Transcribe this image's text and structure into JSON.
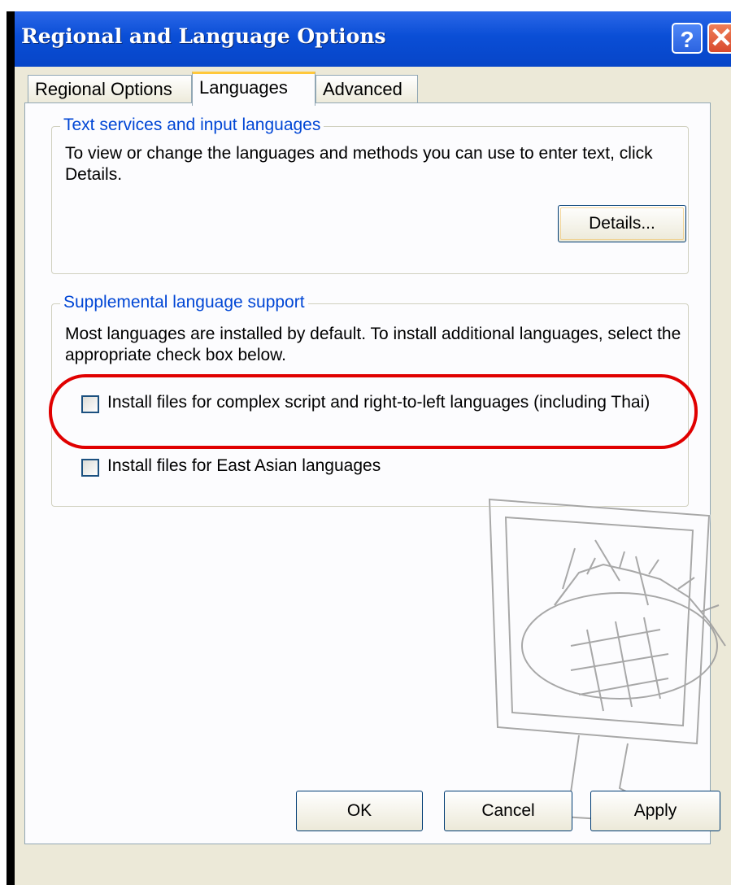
{
  "window": {
    "title": "Regional and Language Options",
    "help_glyph": "?",
    "close_glyph": "✕",
    "titlebar_color": "#0a4ed6"
  },
  "tabs": [
    {
      "label": "Regional Options",
      "selected": false
    },
    {
      "label": "Languages",
      "selected": true
    },
    {
      "label": "Advanced",
      "selected": false
    }
  ],
  "text_services": {
    "legend": "Text services and input languages",
    "description": "To view or change the languages and methods you can use to enter text, click Details.",
    "details_button": "Details..."
  },
  "supplemental": {
    "legend": "Supplemental language support",
    "description": "Most languages are installed by default. To install additional languages, select the appropriate check box below.",
    "checkboxes": [
      {
        "label": "Install files for complex script and right-to-left languages (including Thai)",
        "checked": false
      },
      {
        "label": "Install files for East Asian languages",
        "checked": false
      }
    ]
  },
  "annotation": {
    "color": "#e00000",
    "icon": "red-ellipse-highlight"
  },
  "watermark": {
    "icon": "monitor-watermark-icon"
  },
  "footer": {
    "ok_label": "OK",
    "cancel_label": "Cancel",
    "apply_label": "Apply"
  }
}
